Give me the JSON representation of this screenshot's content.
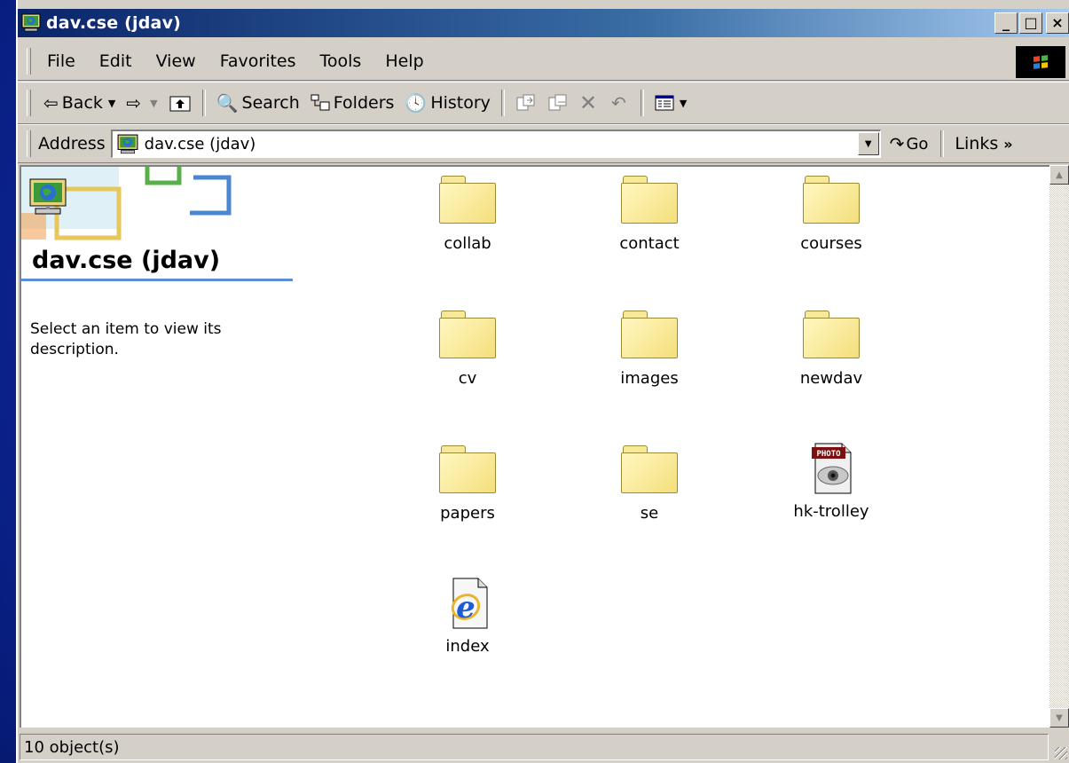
{
  "window": {
    "title": "dav.cse (jdav)",
    "buttons": {
      "minimize": "_",
      "maximize": "□",
      "close": "×"
    }
  },
  "menu": [
    "File",
    "Edit",
    "View",
    "Favorites",
    "Tools",
    "Help"
  ],
  "toolbar": {
    "back": "Back",
    "search": "Search",
    "folders": "Folders",
    "history": "History"
  },
  "address": {
    "label": "Address",
    "value": "dav.cse (jdav)",
    "go": "Go",
    "links": "Links"
  },
  "info_panel": {
    "title": "dav.cse (jdav)",
    "description": "Select an item to view its description."
  },
  "items": [
    {
      "label": "collab",
      "icon": "folder-icon"
    },
    {
      "label": "contact",
      "icon": "folder-icon"
    },
    {
      "label": "courses",
      "icon": "folder-icon"
    },
    {
      "label": "cv",
      "icon": "folder-icon"
    },
    {
      "label": "images",
      "icon": "folder-icon"
    },
    {
      "label": "newdav",
      "icon": "folder-icon"
    },
    {
      "label": "papers",
      "icon": "folder-icon"
    },
    {
      "label": "se",
      "icon": "folder-icon"
    },
    {
      "label": "hk-trolley",
      "icon": "photo-file-icon",
      "badge": "PHOTO"
    },
    {
      "label": "index",
      "icon": "html-file-icon"
    }
  ],
  "status": {
    "text": "10 object(s)"
  },
  "colors": {
    "title_bar_start": "#0a246a",
    "title_bar_end": "#a6caf0",
    "face": "#d4d0c8",
    "folder": "#f4df7c",
    "panel_rule": "#5a8ed8"
  }
}
